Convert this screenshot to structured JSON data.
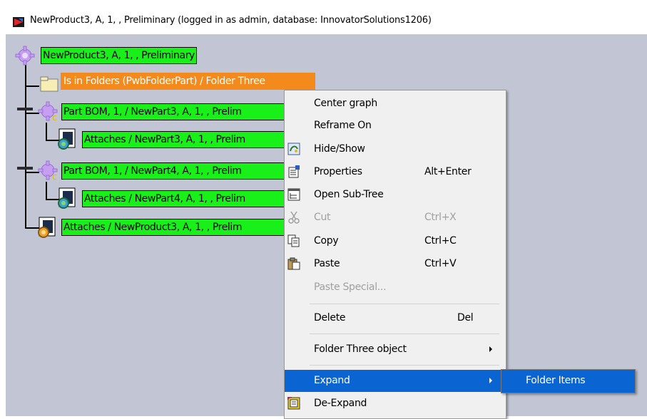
{
  "window": {
    "title": "NewProduct3, A, 1, , Preliminary (logged in as admin, database: InnovatorSolutions1206)"
  },
  "tree": {
    "root": "NewProduct3, A, 1, , Preliminary",
    "nodes": [
      "Is in Folders (PwbFolderPart) / Folder Three",
      "Part BOM, 1,  / NewPart3, A, 1, , Prelim",
      "Attaches / NewPart3, A, 1, , Prelim",
      "Part BOM, 1,  / NewPart4, A, 1, , Prelim",
      "Attaches / NewPart4, A, 1, , Prelim",
      "Attaches / NewProduct3, A, 1, , Prelim"
    ]
  },
  "context_menu": {
    "items": [
      {
        "label": "Center graph",
        "shortcut": ""
      },
      {
        "label": "Reframe On",
        "shortcut": ""
      },
      {
        "label": "Hide/Show",
        "shortcut": ""
      },
      {
        "label": "Properties",
        "shortcut": "Alt+Enter"
      },
      {
        "label": "Open Sub-Tree",
        "shortcut": ""
      },
      {
        "label": "Cut",
        "shortcut": "Ctrl+X"
      },
      {
        "label": "Copy",
        "shortcut": "Ctrl+C"
      },
      {
        "label": "Paste",
        "shortcut": "Ctrl+V"
      },
      {
        "label": "Paste Special...",
        "shortcut": ""
      },
      {
        "label": "Delete",
        "shortcut": "Del"
      },
      {
        "label": "Folder Three object",
        "shortcut": ""
      },
      {
        "label": "Expand",
        "shortcut": ""
      },
      {
        "label": "De-Expand",
        "shortcut": ""
      }
    ]
  },
  "submenu": {
    "items": [
      {
        "label": "Folder Items"
      }
    ]
  },
  "colors": {
    "canvas": "#c2c6d4",
    "node_green": "#19f019",
    "node_orange": "#f58a1c",
    "selection": "#0a64d2"
  }
}
